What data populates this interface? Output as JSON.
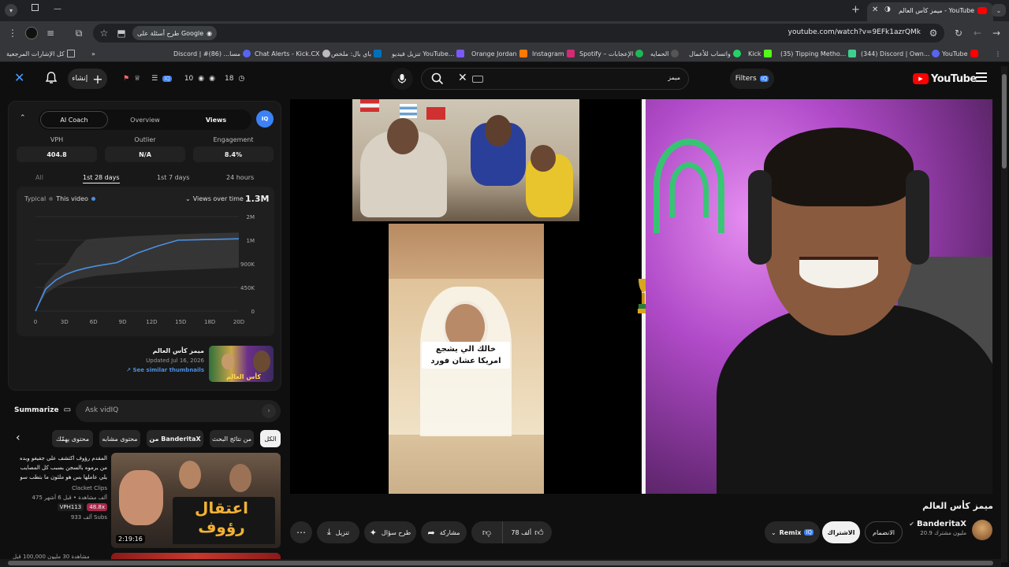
{
  "browser": {
    "tab_title": "ميمز كأس العالم - YouTube",
    "url": "youtube.com/watch?v=9EFk1azrQMk",
    "google_search_chip": "طرح أسئلة على Google",
    "bookmarks": [
      {
        "label": "كل الإشارات المرجعية",
        "color": "#6b6b6b"
      },
      {
        "label": "Discord | #مسا... (86)",
        "color": "#5865f2"
      },
      {
        "label": "Chat Alerts - Kick.CX",
        "color": "#aaa"
      },
      {
        "label": "باي بال: ملخص",
        "color": "#0070ba"
      },
      {
        "label": "تنزيل فيديو YouTube...",
        "color": "#7a5af8"
      },
      {
        "label": "Orange Jordan",
        "color": "#ff7900"
      },
      {
        "label": "Instagram",
        "color": "#d62976"
      },
      {
        "label": "Spotify – الإعجابات",
        "color": "#1db954"
      },
      {
        "label": "الحمايه",
        "color": "#555"
      },
      {
        "label": "واتساب للأعمال",
        "color": "#25d366"
      },
      {
        "label": "Kick",
        "color": "#53fc18"
      },
      {
        "label": "(35) Tipping Metho...",
        "color": "#3ecf8e"
      },
      {
        "label": "(344) Discord | Own...",
        "color": "#5865f2"
      },
      {
        "label": "YouTube",
        "color": "#ff0000"
      }
    ]
  },
  "header": {
    "create_label": "إنشاء",
    "search_text": "ميمز",
    "filters_label": "Filters",
    "logo_text": "YouTube",
    "stat_a": "10",
    "stat_b": "18"
  },
  "vidiq": {
    "tabs": [
      "AI Coach",
      "Overview",
      "Views"
    ],
    "active_tab": "Views",
    "metrics": [
      {
        "label": "VPH",
        "value": "404.8"
      },
      {
        "label": "Outlier",
        "value": "N/A"
      },
      {
        "label": "Engagement",
        "value": "8.4%"
      }
    ],
    "range_tabs": [
      "All",
      "1st 28 days",
      "1st 7 days",
      "24 hours"
    ],
    "legend_typical": "Typical",
    "legend_this": "This video",
    "views_over_time": "Views over time",
    "total_views": "1.3M",
    "thumb_title": "ميمز كأس العالم",
    "thumb_updated": "Updated Jul 16, 2026",
    "see_similar": "See similar thumbnails",
    "summarize": "Summarize",
    "ask_placeholder": "Ask vidIQ"
  },
  "chart_data": {
    "type": "area",
    "x_ticks": [
      "0",
      "3D",
      "6D",
      "9D",
      "12D",
      "15D",
      "18D",
      "20D"
    ],
    "y_ticks": [
      "2M",
      "1M",
      "900K",
      "450K",
      "0"
    ],
    "series": [
      {
        "name": "This video",
        "x": [
          0,
          1,
          2,
          3,
          4,
          5,
          6,
          8,
          10,
          12,
          14,
          16,
          18,
          20
        ],
        "y": [
          0,
          420000,
          590000,
          700000,
          770000,
          820000,
          860000,
          905000,
          945000,
          975000,
          1000000,
          1020000,
          1040000,
          1060000
        ]
      }
    ]
  },
  "chips": [
    "الكل",
    "من نتائج البحث",
    "من BanderitaX",
    "محتوى مشابه",
    "محتوى يهمّك"
  ],
  "sidebar_video": {
    "title": "المقدم رؤوف اكتشف على جفيغو وبده من يرموه بالسجن بسبب كل المصايب يلي عاملها بس هو ملئون ما بتطب سو",
    "channel": "Clacket Clips",
    "meta": "475 ألف مشاهدة • قبل 6 أشهر",
    "badge_a": "48.8x",
    "badge_b": "VPH113",
    "subs": "933 ألف Subs",
    "duration": "2:19:16",
    "thumb_text": "اعتقال رؤوف",
    "next_meta": "مشاهدة 30 مليون 100,000 قبل"
  },
  "video": {
    "title": "ميمز كأس العالم",
    "channel": "BanderitaX",
    "subscribers": "20.9 مليون مشترك",
    "join_label": "الانضمام",
    "subscribe_label": "الاشتراك",
    "remix_label": "Remix",
    "likes": "78 ألف",
    "share_label": "مشاركة",
    "ask_label": "طرح سؤال",
    "download_label": "تنزيل",
    "caption": "خالك الي يشجع امريكا عشان فورد"
  }
}
